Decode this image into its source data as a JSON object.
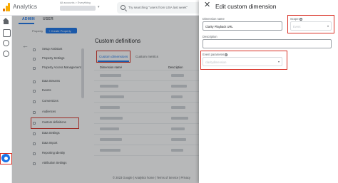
{
  "app": {
    "title": "Analytics",
    "account_crumb": "All accounts > Everything"
  },
  "search": {
    "placeholder": "Try searching \"users from USA last week\""
  },
  "admin": {
    "tabs": [
      {
        "label": "ADMIN"
      },
      {
        "label": "USER"
      }
    ],
    "property_label": "Property",
    "create_property_label": "+ Create Property",
    "menu": [
      {
        "label": "Setup Assistant"
      },
      {
        "label": "Property Settings"
      },
      {
        "label": "Property Access Management"
      },
      {
        "label": "Data Streams"
      },
      {
        "label": "Events"
      },
      {
        "label": "Conversions"
      },
      {
        "label": "Audiences"
      },
      {
        "label": "Custom definitions"
      },
      {
        "label": "Data Settings"
      },
      {
        "label": "Data Import"
      },
      {
        "label": "Reporting Identity"
      },
      {
        "label": "Attribution Settings"
      }
    ]
  },
  "content": {
    "title": "Custom definitions",
    "tabs": [
      {
        "label": "Custom dimensions"
      },
      {
        "label": "Custom metrics"
      }
    ],
    "columns": {
      "dimension_name": "Dimension name",
      "description": "Description"
    },
    "sort_glyph": "↓",
    "footer": "© 2023 Google | Analytics home | Terms of Service | Privacy"
  },
  "drawer": {
    "title": "Edit custom dimension",
    "close_glyph": "✕",
    "dimension_name": {
      "label": "Dimension name",
      "value": "Clarity Playback URL"
    },
    "scope": {
      "label": "Scope",
      "value": "Event"
    },
    "description": {
      "label": "Description"
    },
    "event_parameter": {
      "label": "Event parameter",
      "value": "claritydimension"
    }
  }
}
